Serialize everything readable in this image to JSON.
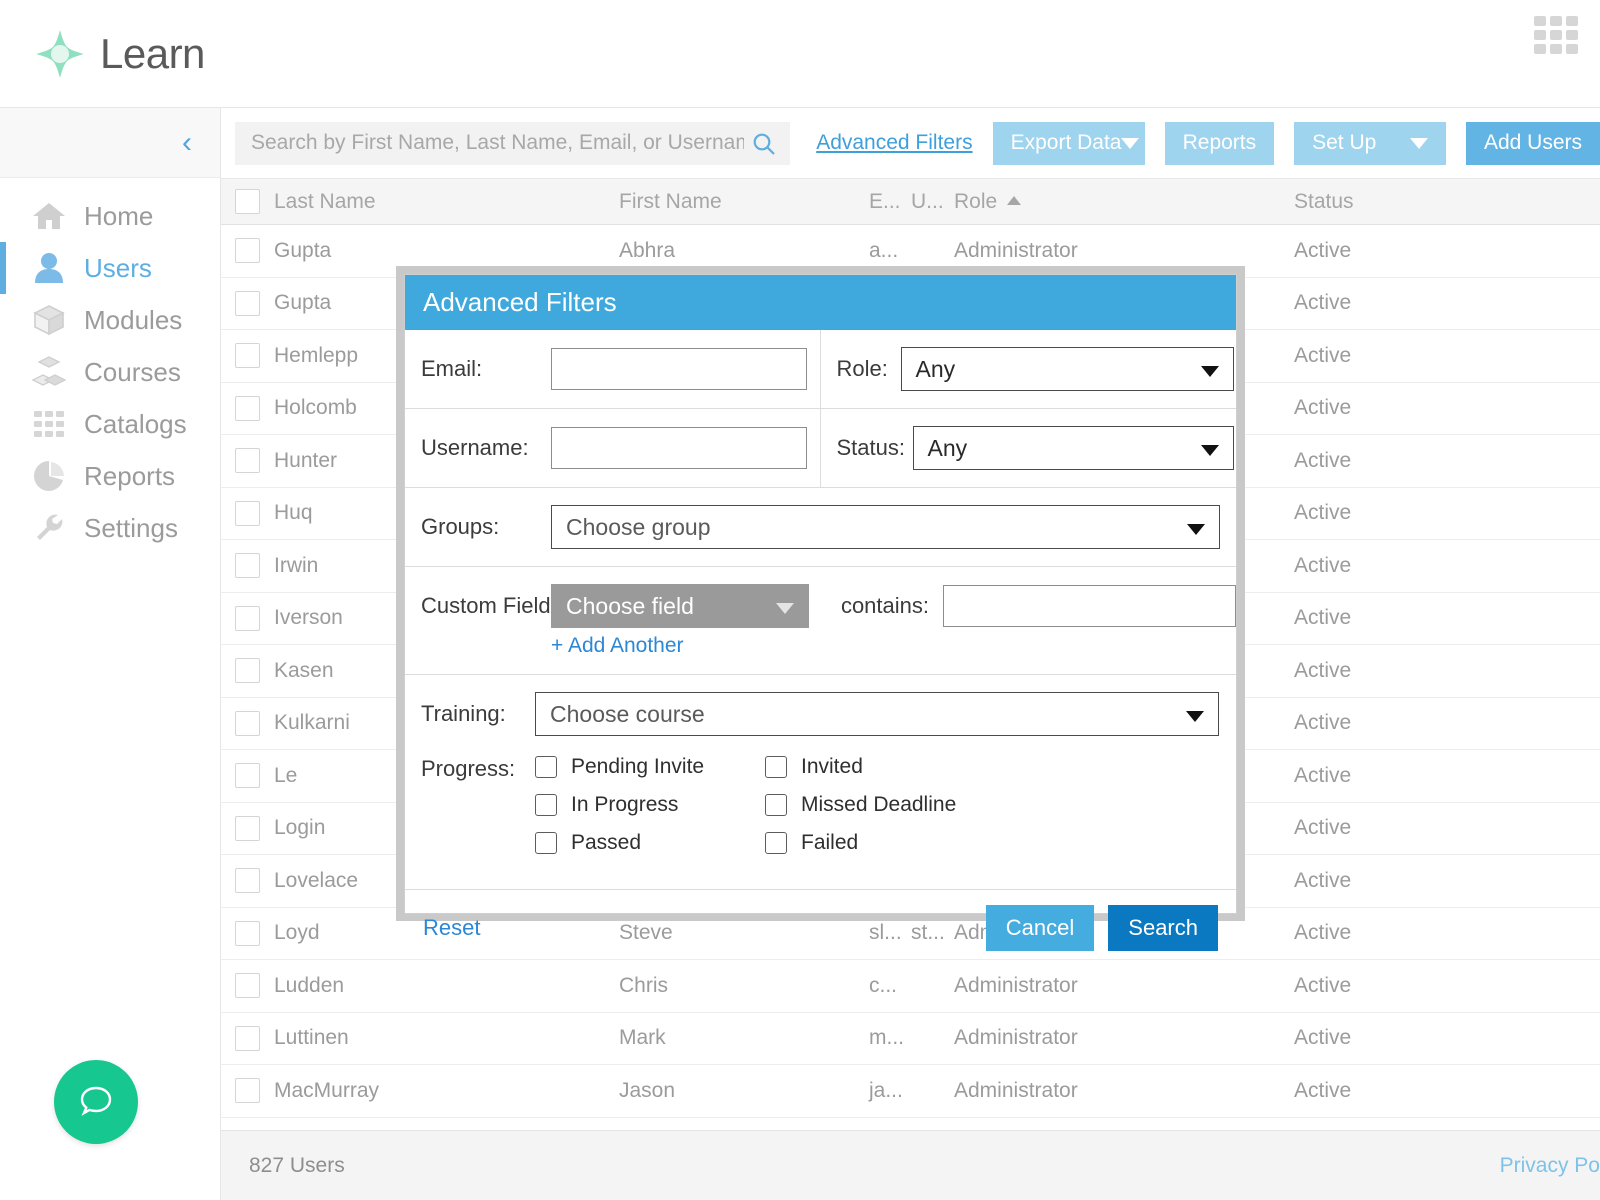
{
  "app": {
    "brand_name": "Learn",
    "logo_icon": "four-petal-star-icon",
    "app_launcher_icon": "apps-grid-icon"
  },
  "sidebar": {
    "collapse_icon": "chevron-left-icon",
    "items": [
      {
        "label": "Home",
        "icon": "home-icon",
        "active": false
      },
      {
        "label": "Users",
        "icon": "user-icon",
        "active": true
      },
      {
        "label": "Modules",
        "icon": "cube-icon",
        "active": false
      },
      {
        "label": "Courses",
        "icon": "cubes-icon",
        "active": false
      },
      {
        "label": "Catalogs",
        "icon": "grid-icon",
        "active": false
      },
      {
        "label": "Reports",
        "icon": "pie-chart-icon",
        "active": false
      },
      {
        "label": "Settings",
        "icon": "wrench-icon",
        "active": false
      }
    ],
    "help_icon": "chat-bubble-icon"
  },
  "toolbar": {
    "search_placeholder": "Search by First Name, Last Name, Email, or Username",
    "search_value": "",
    "search_icon": "search-icon",
    "advanced_filters_link": "Advanced Filters",
    "export_data": "Export Data",
    "reports": "Reports",
    "set_up": "Set Up",
    "add_users": "Add Users"
  },
  "table": {
    "columns": [
      "Last Name",
      "First Name",
      "E...",
      "U...",
      "Role",
      "Status"
    ],
    "sorted_column": "Role",
    "sort_direction": "ascending",
    "rows": [
      {
        "last": "Gupta",
        "first": "Abhra",
        "email": "a...",
        "username": "",
        "role": "Administrator",
        "status": "Active"
      },
      {
        "last": "Gupta",
        "first": "",
        "email": "",
        "username": "",
        "role": "",
        "status": "Active"
      },
      {
        "last": "Hemlepp",
        "first": "",
        "email": "",
        "username": "",
        "role": "",
        "status": "Active"
      },
      {
        "last": "Holcomb",
        "first": "",
        "email": "",
        "username": "",
        "role": "",
        "status": "Active"
      },
      {
        "last": "Hunter",
        "first": "",
        "email": "",
        "username": "",
        "role": "",
        "status": "Active"
      },
      {
        "last": "Huq",
        "first": "",
        "email": "",
        "username": "",
        "role": "",
        "status": "Active"
      },
      {
        "last": "Irwin",
        "first": "",
        "email": "",
        "username": "",
        "role": "",
        "status": "Active"
      },
      {
        "last": "Iverson",
        "first": "",
        "email": "",
        "username": "",
        "role": "",
        "status": "Active"
      },
      {
        "last": "Kasen",
        "first": "",
        "email": "",
        "username": "",
        "role": "",
        "status": "Active"
      },
      {
        "last": "Kulkarni",
        "first": "",
        "email": "",
        "username": "",
        "role": "",
        "status": "Active"
      },
      {
        "last": "Le",
        "first": "",
        "email": "",
        "username": "",
        "role": "",
        "status": "Active"
      },
      {
        "last": "Login",
        "first": "",
        "email": "",
        "username": "",
        "role": "",
        "status": "Active"
      },
      {
        "last": "Lovelace",
        "first": "",
        "email": "",
        "username": "",
        "role": "",
        "status": "Active"
      },
      {
        "last": "Loyd",
        "first": "Steve",
        "email": "sl...",
        "username": "st...",
        "role": "Administrator",
        "status": "Active"
      },
      {
        "last": "Ludden",
        "first": "Chris",
        "email": "c...",
        "username": "",
        "role": "Administrator",
        "status": "Active"
      },
      {
        "last": "Luttinen",
        "first": "Mark",
        "email": "m...",
        "username": "",
        "role": "Administrator",
        "status": "Active"
      },
      {
        "last": "MacMurray",
        "first": "Jason",
        "email": "ja...",
        "username": "",
        "role": "Administrator",
        "status": "Active"
      }
    ],
    "footer_count": "827 Users",
    "privacy_link": "Privacy Po"
  },
  "modal": {
    "title": "Advanced Filters",
    "email_label": "Email:",
    "email_value": "",
    "username_label": "Username:",
    "username_value": "",
    "role_label": "Role:",
    "role_value": "Any",
    "status_label": "Status:",
    "status_value": "Any",
    "groups_label": "Groups:",
    "groups_value": "Choose group",
    "custom_field_label": "Custom Field:",
    "custom_field_value": "Choose field",
    "contains_label": "contains:",
    "contains_value": "",
    "add_another": "+ Add Another",
    "training_label": "Training:",
    "training_value": "Choose course",
    "progress_label": "Progress:",
    "progress_options": [
      {
        "label": "Pending Invite",
        "checked": false
      },
      {
        "label": "Invited",
        "checked": false
      },
      {
        "label": "In Progress",
        "checked": false
      },
      {
        "label": "Missed Deadline",
        "checked": false
      },
      {
        "label": "Passed",
        "checked": false
      },
      {
        "label": "Failed",
        "checked": false
      }
    ],
    "reset": "Reset",
    "cancel": "Cancel",
    "search": "Search"
  },
  "colors": {
    "accent_blue": "#3fa9dd",
    "primary_button": "#0b79c1",
    "brand_green": "#16c78f",
    "nav_active": "#5eaee2"
  }
}
